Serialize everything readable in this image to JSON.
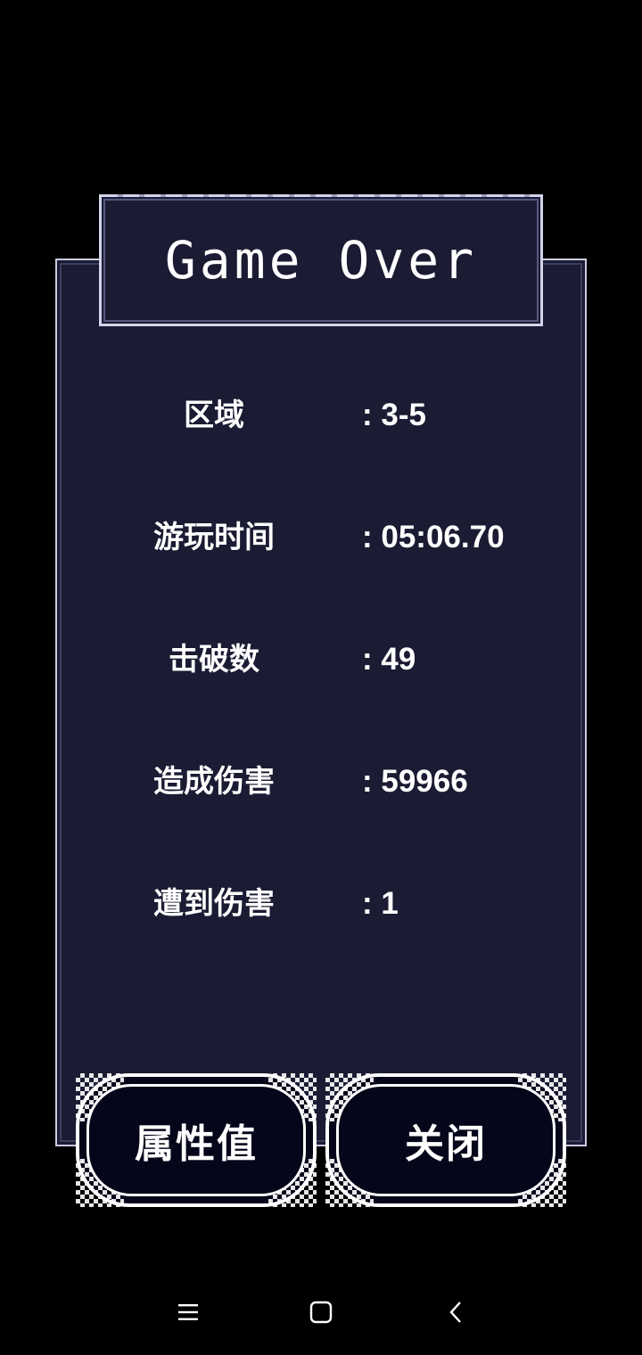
{
  "title": "Game Over",
  "stats": [
    {
      "label": "区域",
      "value": ": 3-5"
    },
    {
      "label": "游玩时间",
      "value": ": 05:06.70"
    },
    {
      "label": "击破数",
      "value": ": 49"
    },
    {
      "label": "造成伤害",
      "value": ": 59966"
    },
    {
      "label": "遭到伤害",
      "value": ": 1"
    }
  ],
  "buttons": {
    "attributes": "属性值",
    "close": "关闭"
  },
  "navbar": {
    "icons": [
      "menu-icon",
      "home-icon",
      "back-icon"
    ]
  },
  "colors": {
    "background": "#000000",
    "panel": "#1b1c33",
    "panel_border": "#c9cbe0",
    "button_fill": "#05061a",
    "text": "#ffffff"
  }
}
